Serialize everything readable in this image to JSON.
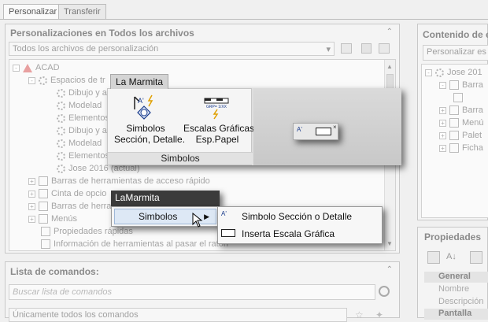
{
  "tabs": [
    "Personalizar",
    "Transferir"
  ],
  "left_panel": {
    "title": "Personalizaciones en Todos los archivos",
    "filter": "Todos los archivos de personalización",
    "tree": [
      "ACAD",
      "Espacios de tr",
      "Dibujo y a",
      "Modelad",
      "Elementos",
      "Dibujo y a",
      "Modelad",
      "Elementos",
      "Jose 2016 (actual)",
      "Barras de herramientas de acceso rápido",
      "Cinta de opcio",
      "Barras de herra",
      "Menús",
      "Propiedades rápidas",
      "Información de herramientas al pasar el ratón"
    ]
  },
  "commands_panel": {
    "title": "Lista de comandos:",
    "search_placeholder": "Buscar lista de comandos",
    "filter": "Únicamente todos los comandos"
  },
  "right_panel": {
    "title": "Contenido de e",
    "button": "Personalizar es",
    "tree": [
      "Jose 201",
      "Barra",
      "Barra",
      "Menú",
      "Palet",
      "Ficha"
    ]
  },
  "props_panel": {
    "title": "Propiedades",
    "sections": [
      "General",
      "Pantalla"
    ],
    "rows": [
      "Nombre",
      "Descripción"
    ]
  },
  "ribbon": {
    "tab_label": "La Marmita",
    "button1_line1": "Simbolos",
    "button1_line2": "Sección, Detalle.",
    "button2_line1": "Escalas Gráficas",
    "button2_line2": "Esp.Papel",
    "panel_label": "Simbolos",
    "icon_text": "GRP= 1/XX"
  },
  "menu": {
    "title": "LaMarmita",
    "item": "Simbolos",
    "submenu": [
      "Simbolo Sección o Detalle",
      "Inserta Escala Gráfica"
    ]
  }
}
